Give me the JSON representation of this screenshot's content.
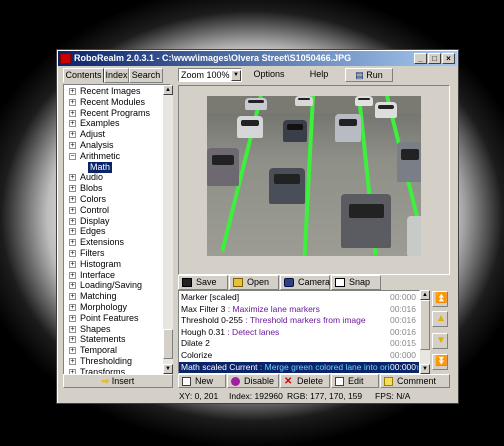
{
  "window": {
    "title": "RoboRealm 2.0.3.1 - C:\\www\\images\\Olvera Street\\S1050466.JPG",
    "controls": {
      "minimize": "_",
      "maximize": "□",
      "close": "×"
    }
  },
  "sidebar": {
    "tabs": [
      "Contents",
      "Index",
      "Search"
    ],
    "tree": [
      {
        "label": "Recent Images",
        "expander": "+"
      },
      {
        "label": "Recent Modules",
        "expander": "+"
      },
      {
        "label": "Recent Programs",
        "expander": "+"
      },
      {
        "label": "Examples",
        "expander": "+"
      },
      {
        "label": "Adjust",
        "expander": "+"
      },
      {
        "label": "Analysis",
        "expander": "+"
      },
      {
        "label": "Arithmetic",
        "expander": "−"
      },
      {
        "label": "Math",
        "expander": "",
        "selected": true
      },
      {
        "label": "Audio",
        "expander": "+"
      },
      {
        "label": "Blobs",
        "expander": "+"
      },
      {
        "label": "Colors",
        "expander": "+"
      },
      {
        "label": "Control",
        "expander": "+"
      },
      {
        "label": "Display",
        "expander": "+"
      },
      {
        "label": "Edges",
        "expander": "+"
      },
      {
        "label": "Extensions",
        "expander": "+"
      },
      {
        "label": "Filters",
        "expander": "+"
      },
      {
        "label": "Histogram",
        "expander": "+"
      },
      {
        "label": "Interface",
        "expander": "+"
      },
      {
        "label": "Loading/Saving",
        "expander": "+"
      },
      {
        "label": "Matching",
        "expander": "+"
      },
      {
        "label": "Morphology",
        "expander": "+"
      },
      {
        "label": "Point Features",
        "expander": "+"
      },
      {
        "label": "Shapes",
        "expander": "+"
      },
      {
        "label": "Statements",
        "expander": "+"
      },
      {
        "label": "Temporal",
        "expander": "+"
      },
      {
        "label": "Thresholding",
        "expander": "+"
      },
      {
        "label": "Transforms",
        "expander": "+"
      }
    ],
    "insert_label": "Insert"
  },
  "toolbar": {
    "zoom_value": "Zoom 100%",
    "options_label": "Options",
    "help_label": "Help",
    "run_label": "Run"
  },
  "image_buttons": {
    "save": "Save",
    "open": "Open",
    "camera": "Camera",
    "snap": "Snap"
  },
  "pipeline": [
    {
      "name": "Marker [scaled]",
      "desc": "",
      "time": "00:000"
    },
    {
      "name": "Max Filter 3",
      "desc": ": Maximize lane markers",
      "time": "00:016"
    },
    {
      "name": "Threshold 0-255",
      "desc": ": Threshold markers from image",
      "time": "00:016"
    },
    {
      "name": "Hough 0.31",
      "desc": ": Detect lanes",
      "time": "00:016"
    },
    {
      "name": "Dilate 2",
      "desc": "",
      "time": "00:015"
    },
    {
      "name": "Colorize",
      "desc": "",
      "time": "00:000"
    },
    {
      "name": "Math scaled Current",
      "desc": ": Merge green colored lane into original image",
      "time": "00:000",
      "selected": true
    }
  ],
  "pipeline_buttons": {
    "new": "New",
    "disable": "Disable",
    "delete": "Delete",
    "edit": "Edit",
    "comment": "Comment"
  },
  "status": {
    "xy": "XY: 0, 201",
    "index": "Index: 192960",
    "rgb": "RGB: 177, 170, 159",
    "fps": "FPS: N/A"
  },
  "colors": {
    "title_start": "#0a246a",
    "title_end": "#a6caf0",
    "lane_green": "#3cf03c",
    "selection": "#0a246a",
    "desc_purple": "#6a1b9a"
  }
}
